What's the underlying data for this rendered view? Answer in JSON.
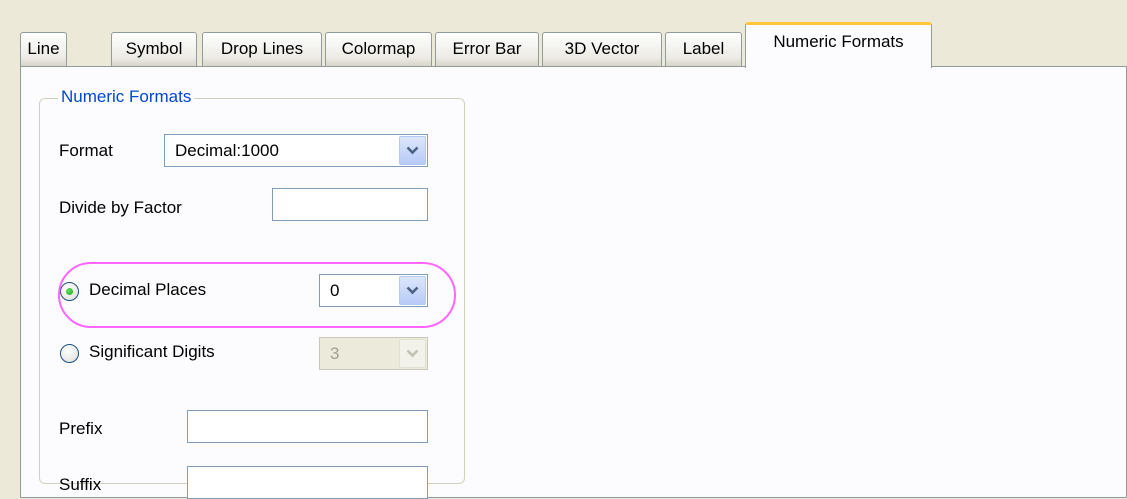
{
  "tabs": [
    {
      "label": "Line"
    },
    {
      "label": "Symbol"
    },
    {
      "label": "Drop Lines"
    },
    {
      "label": "Colormap"
    },
    {
      "label": "Error Bar"
    },
    {
      "label": "3D Vector"
    },
    {
      "label": "Label"
    },
    {
      "label": "Numeric Formats"
    }
  ],
  "active_tab": "Numeric Formats",
  "group": {
    "title": "Numeric Formats",
    "format_label": "Format",
    "format_value": "Decimal:1000",
    "divide_label": "Divide by Factor",
    "divide_value": "",
    "decimal_places_label": "Decimal Places",
    "decimal_places_value": "0",
    "decimal_places_selected": true,
    "significant_digits_label": "Significant Digits",
    "significant_digits_value": "3",
    "significant_digits_selected": false,
    "prefix_label": "Prefix",
    "prefix_value": "",
    "suffix_label": "Suffix",
    "suffix_value": ""
  },
  "colors": {
    "group_title": "#0046d5",
    "active_tab_accent": "#ffc83c",
    "highlight_annotation": "#ff66ff"
  },
  "icons": {
    "dropdown": "chevron-down-icon",
    "radio": "radio-button-icon"
  }
}
